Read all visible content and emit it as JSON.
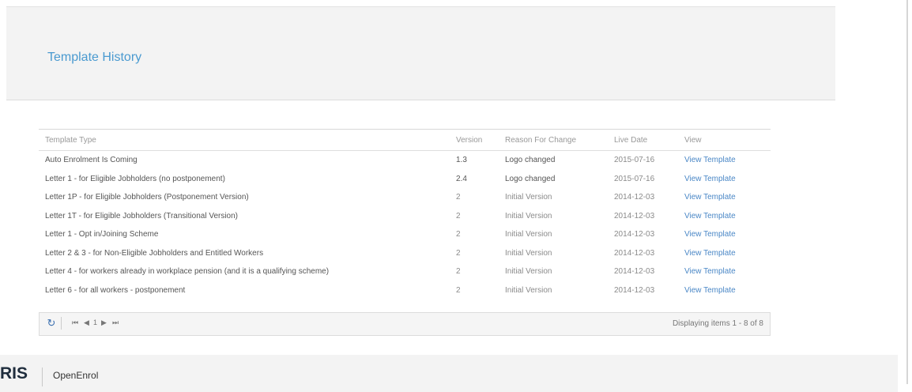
{
  "header": {
    "title": "Template History"
  },
  "table": {
    "columns": [
      "Template Type",
      "Version",
      "Reason For Change",
      "Live Date",
      "View"
    ],
    "rows": [
      [
        "Auto Enrolment Is Coming",
        "1.3",
        "Logo changed",
        "2015-07-16",
        "View Template"
      ],
      [
        "Letter 1 - for Eligible Jobholders (no postponement)",
        "2.4",
        "Logo changed",
        "2015-07-16",
        "View Template"
      ],
      [
        "Letter 1P - for Eligible Jobholders (Postponement Version)",
        "2",
        "Initial Version",
        "2014-12-03",
        "View Template"
      ],
      [
        "Letter 1T - for Eligible Jobholders (Transitional Version)",
        "2",
        "Initial Version",
        "2014-12-03",
        "View Template"
      ],
      [
        "Letter 1 - Opt in/Joining Scheme",
        "2",
        "Initial Version",
        "2014-12-03",
        "View Template"
      ],
      [
        "Letter 2 & 3 - for Non-Eligible Jobholders and Entitled Workers",
        "2",
        "Initial Version",
        "2014-12-03",
        "View Template"
      ],
      [
        "Letter 4 - for workers already in workplace pension (and it is a qualifying scheme)",
        "2",
        "Initial Version",
        "2014-12-03",
        "View Template"
      ],
      [
        "Letter 6 - for all workers - postponement",
        "2",
        "Initial Version",
        "2014-12-03",
        "View Template"
      ]
    ]
  },
  "pager": {
    "refresh_icon": "refresh-icon",
    "first_icon": "first-page-icon",
    "prev_icon": "prev-page-icon",
    "page": "1",
    "next_icon": "next-page-icon",
    "last_icon": "last-page-icon",
    "info": "Displaying items 1 - 8 of 8"
  },
  "footer": {
    "logo": "RIS",
    "product": "OpenEnrol"
  },
  "colors": {
    "accent": "#4a9ad0",
    "link": "#4a87c6"
  }
}
